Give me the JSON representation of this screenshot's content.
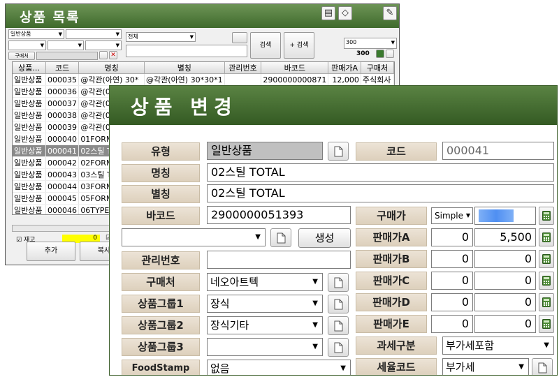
{
  "list_window": {
    "title": "상품 목록",
    "filter_type": "일반상품",
    "filter_all": "전체",
    "search_label": "검색",
    "plus_search_label": "+ 검색",
    "page_size": "300",
    "result_count": "300",
    "buyer_tab": "구매처",
    "columns": [
      "상품...",
      "코드",
      "명칭",
      "별칭",
      "관리번호",
      "바코드",
      "판매가A",
      "구매처"
    ],
    "rows": [
      [
        "일반상품",
        "000035",
        "@각관(아연) 30*",
        "@각관(아연) 30*30*1",
        "",
        "2900000000871",
        "12,000",
        "주식회사"
      ],
      [
        "일반상품",
        "000036",
        "@각관(0",
        "",
        "",
        "",
        "",
        ""
      ],
      [
        "일반상품",
        "000037",
        "@각관(0",
        "",
        "",
        "",
        "",
        ""
      ],
      [
        "일반상품",
        "000038",
        "@각관(0",
        "",
        "",
        "",
        "",
        ""
      ],
      [
        "일반상품",
        "000039",
        "@각관(0",
        "",
        "",
        "",
        "",
        ""
      ],
      [
        "일반상품",
        "000040",
        "01FORM",
        "",
        "",
        "",
        "",
        ""
      ],
      [
        "일반상품",
        "000041",
        "02스틸 T",
        "",
        "",
        "",
        "",
        ""
      ],
      [
        "일반상품",
        "000042",
        "02FORM",
        "",
        "",
        "",
        "",
        ""
      ],
      [
        "일반상품",
        "000043",
        "03스틸 T",
        "",
        "",
        "",
        "",
        ""
      ],
      [
        "일반상품",
        "000044",
        "03FORM",
        "",
        "",
        "",
        "",
        ""
      ],
      [
        "일반상품",
        "000045",
        "05FORM",
        "",
        "",
        "",
        "",
        ""
      ],
      [
        "일반상품",
        "000046",
        "06TYPE",
        "",
        "",
        "",
        "",
        ""
      ]
    ],
    "stock_check_label": "재고",
    "stock_value": "0",
    "add_button": "추가",
    "copy_button": "복사"
  },
  "edit_window": {
    "title": "상품 변경",
    "type_label": "유형",
    "type_value": "일반상품",
    "code_label": "코드",
    "code_value": "000041",
    "name_label": "명칭",
    "name_value": "02스틸 TOTAL",
    "alias_label": "별칭",
    "alias_value": "02스틸 TOTAL",
    "barcode_label": "바코드",
    "barcode_value": "2900000051393",
    "generate_button": "생성",
    "mgmt_label": "관리번호",
    "mgmt_value": "",
    "supplier_label": "구매처",
    "supplier_value": "네오아트텍",
    "group1_label": "상품그룹1",
    "group1_value": "장식",
    "group2_label": "상품그룹2",
    "group2_value": "장식기타",
    "group3_label": "상품그룹3",
    "group3_value": "",
    "foodstamp_label": "FoodStamp",
    "foodstamp_value": "없음",
    "purchase_label": "구매가",
    "purchase_mode": "Simple",
    "price_a_label": "판매가A",
    "price_a_qty": "0",
    "price_a_value": "5,500",
    "price_b_label": "판매가B",
    "price_b_qty": "0",
    "price_b_value": "0",
    "price_c_label": "판매가C",
    "price_c_qty": "0",
    "price_c_value": "0",
    "price_d_label": "판매가D",
    "price_d_qty": "0",
    "price_d_value": "0",
    "price_e_label": "판매가E",
    "price_e_qty": "0",
    "price_e_value": "0",
    "tax_label": "과세구분",
    "tax_value": "부가세포함",
    "taxcode_label": "세율코드",
    "taxcode_value": "부가세"
  },
  "colors": {
    "title_green": "#3f6a2c",
    "label_beige": "#e3d8c7",
    "selected_row": "#8a8a8a",
    "calc_green": "#4c8a35",
    "blurred_blue": "#4f8ff2"
  }
}
